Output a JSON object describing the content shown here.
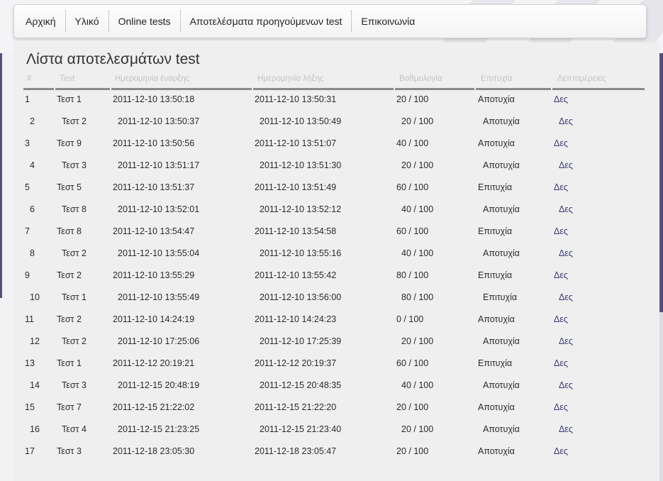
{
  "nav": {
    "items": [
      "Αρχική",
      "Υλικό",
      "Online tests",
      "Αποτελέσματα προηγούμενων test",
      "Επικοινωνία"
    ]
  },
  "page": {
    "title": "Λίστα αποτελεσμάτων test"
  },
  "table": {
    "headers": [
      "#",
      "Test",
      "Ημερομηνία έναρξης",
      "Ημερομηνία λήξης",
      "Βαθμολογία",
      "Επιτυχία",
      "Λεπτομέρειες"
    ],
    "rows": [
      [
        "1",
        "Τεστ 1",
        "2011-12-10 13:50:18",
        "2011-12-10 13:50:31",
        "20 / 100",
        "Αποτυχία",
        "Δες"
      ],
      [
        "2",
        "Τεστ 2",
        "2011-12-10 13:50:37",
        "2011-12-10 13:50:49",
        "20 / 100",
        "Αποτυχία",
        "Δες"
      ],
      [
        "3",
        "Τεστ 9",
        "2011-12-10 13:50:56",
        "2011-12-10 13:51:07",
        "40 / 100",
        "Αποτυχία",
        "Δες"
      ],
      [
        "4",
        "Τεστ 3",
        "2011-12-10 13:51:17",
        "2011-12-10 13:51:30",
        "20 / 100",
        "Αποτυχία",
        "Δες"
      ],
      [
        "5",
        "Τεστ 5",
        "2011-12-10 13:51:37",
        "2011-12-10 13:51:49",
        "60 / 100",
        "Επιτυχία",
        "Δες"
      ],
      [
        "6",
        "Τεστ 8",
        "2011-12-10 13:52:01",
        "2011-12-10 13:52:12",
        "40 / 100",
        "Αποτυχία",
        "Δες"
      ],
      [
        "7",
        "Τεστ 8",
        "2011-12-10 13:54:47",
        "2011-12-10 13:54:58",
        "60 / 100",
        "Επιτυχία",
        "Δες"
      ],
      [
        "8",
        "Τεστ 2",
        "2011-12-10 13:55:04",
        "2011-12-10 13:55:16",
        "40 / 100",
        "Αποτυχία",
        "Δες"
      ],
      [
        "9",
        "Τεστ 2",
        "2011-12-10 13:55:29",
        "2011-12-10 13:55:42",
        "80 / 100",
        "Επιτυχία",
        "Δες"
      ],
      [
        "10",
        "Τεστ 1",
        "2011-12-10 13:55:49",
        "2011-12-10 13:56:00",
        "80 / 100",
        "Επιτυχία",
        "Δες"
      ],
      [
        "11",
        "Τεστ 2",
        "2011-12-10 14:24:19",
        "2011-12-10 14:24:23",
        "0 / 100",
        "Αποτυχία",
        "Δες"
      ],
      [
        "12",
        "Τεστ 2",
        "2011-12-10 17:25:06",
        "2011-12-10 17:25:39",
        "20 / 100",
        "Αποτυχία",
        "Δες"
      ],
      [
        "13",
        "Τεστ 1",
        "2011-12-12 20:19:21",
        "2011-12-12 20:19:37",
        "60 / 100",
        "Επιτυχία",
        "Δες"
      ],
      [
        "14",
        "Τεστ 3",
        "2011-12-15 20:48:19",
        "2011-12-15 20:48:35",
        "40 / 100",
        "Αποτυχία",
        "Δες"
      ],
      [
        "15",
        "Τεστ 7",
        "2011-12-15 21:22:02",
        "2011-12-15 21:22:20",
        "20 / 100",
        "Αποτυχία",
        "Δες"
      ],
      [
        "16",
        "Τεστ 4",
        "2011-12-15 21:23:25",
        "2011-12-15 21:23:40",
        "20 / 100",
        "Αποτυχία",
        "Δες"
      ],
      [
        "17",
        "Τεστ 3",
        "2011-12-18 23:05:30",
        "2011-12-18 23:05:47",
        "20 / 100",
        "Αποτυχία",
        "Δες"
      ]
    ]
  },
  "colors": {
    "accent": "#55507a",
    "link": "#3a3a70",
    "header_text": "#c3c3c3"
  }
}
